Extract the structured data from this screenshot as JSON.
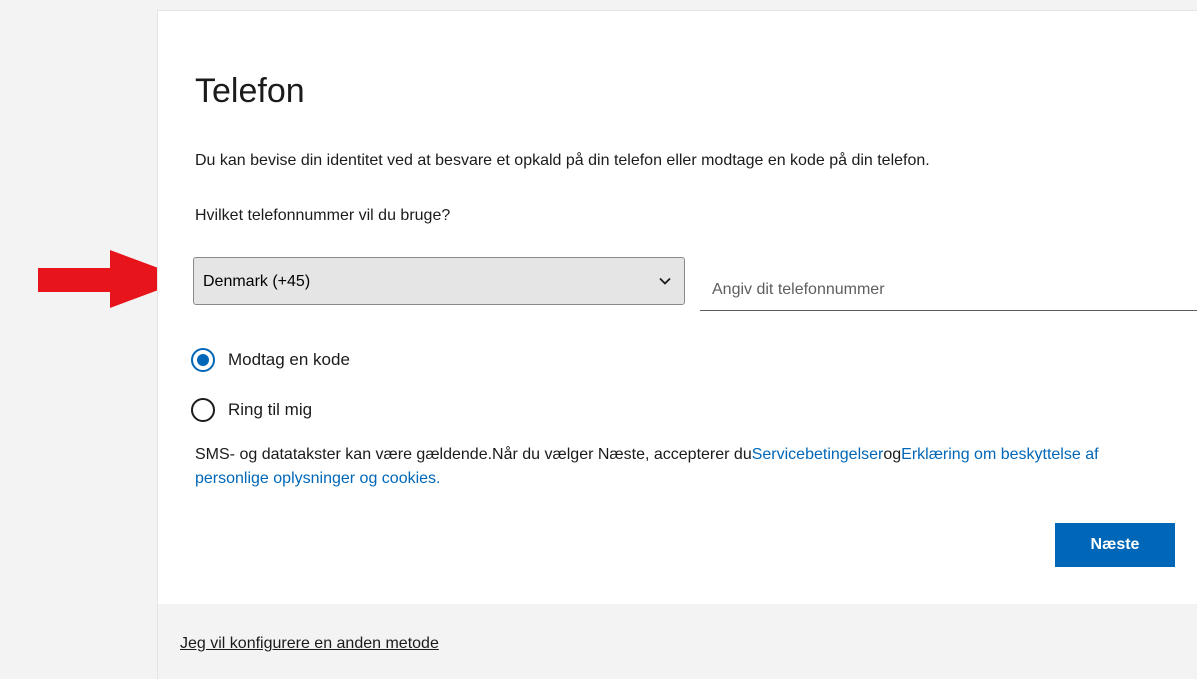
{
  "header": {
    "title": "Telefon"
  },
  "main": {
    "description": "Du kan bevise din identitet ved at besvare et opkald på din telefon eller modtage en kode på din telefon.",
    "question": "Hvilket telefonnummer vil du bruge?",
    "country_select": {
      "selected": "Denmark (+45)",
      "icon": "chevron-down-icon"
    },
    "phone_input": {
      "value": "",
      "placeholder": "Angiv dit telefonnummer"
    },
    "options": [
      {
        "label": "Modtag en kode",
        "checked": true
      },
      {
        "label": "Ring til mig",
        "checked": false
      }
    ],
    "legal": {
      "text": "SMS- og datatakster kan være gældende.Når du vælger Næste, accepterer du",
      "terms_link": "Servicebetingelser",
      "and": "og",
      "privacy_link": "Erklæring om beskyttelse af personlige oplysninger og cookies."
    },
    "next_button": "Næste"
  },
  "footer": {
    "alt_method_link": "Jeg vil konfigurere en anden metode"
  },
  "annotation": {
    "arrow_color": "#e8141b",
    "arrow_icon": "red-arrow-right-icon"
  },
  "colors": {
    "accent": "#0067b8",
    "page_bg": "#f3f3f3",
    "card_bg": "#ffffff",
    "select_bg": "#e5e5e5"
  }
}
